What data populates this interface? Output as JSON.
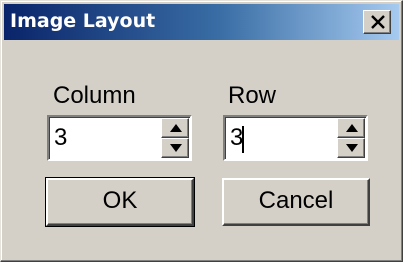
{
  "window": {
    "title": "Image Layout",
    "close_icon": "close-icon"
  },
  "fields": {
    "column_label": "Column",
    "column_value": "3",
    "row_label": "Row",
    "row_value": "3"
  },
  "buttons": {
    "ok": "OK",
    "cancel": "Cancel"
  },
  "colors": {
    "titlebar_start": "#0a246a",
    "titlebar_end": "#a6caf0",
    "face": "#d4d0c8"
  }
}
